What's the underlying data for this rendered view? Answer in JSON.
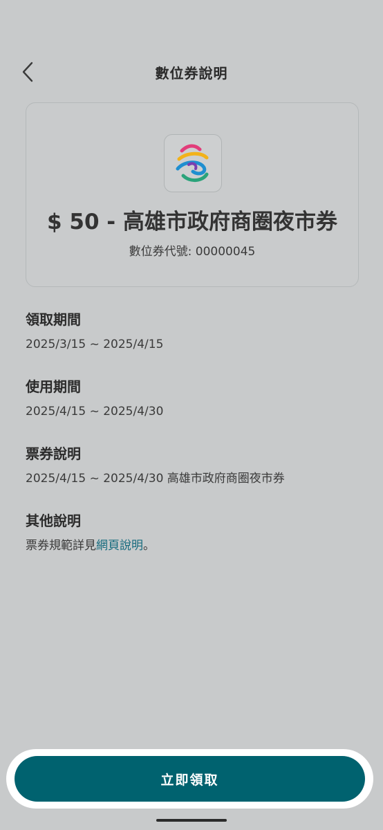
{
  "header": {
    "back_icon": "chevron-left-icon",
    "title": "數位券說明"
  },
  "voucher": {
    "logo_icon": "kaohsiung-city-logo",
    "title": "$ 50 - 高雄市政府商圈夜市券",
    "code_label": "數位券代號:",
    "code_value": "00000045"
  },
  "sections": {
    "claim_period": {
      "heading": "領取期間",
      "value": "2025/3/15 ~ 2025/4/15"
    },
    "use_period": {
      "heading": "使用期間",
      "value": "2025/4/15 ~ 2025/4/30"
    },
    "ticket_desc": {
      "heading": "票券說明",
      "value": "2025/4/15 ~ 2025/4/30 高雄市政府商圈夜市券"
    },
    "other_desc": {
      "heading": "其他說明",
      "prefix": "票券規範詳見",
      "link_text": "網頁說明",
      "suffix": "。"
    }
  },
  "footer": {
    "claim_label": "立即領取"
  },
  "colors": {
    "background": "#c8cacb",
    "accent": "#00626f",
    "link": "#166b7e"
  }
}
